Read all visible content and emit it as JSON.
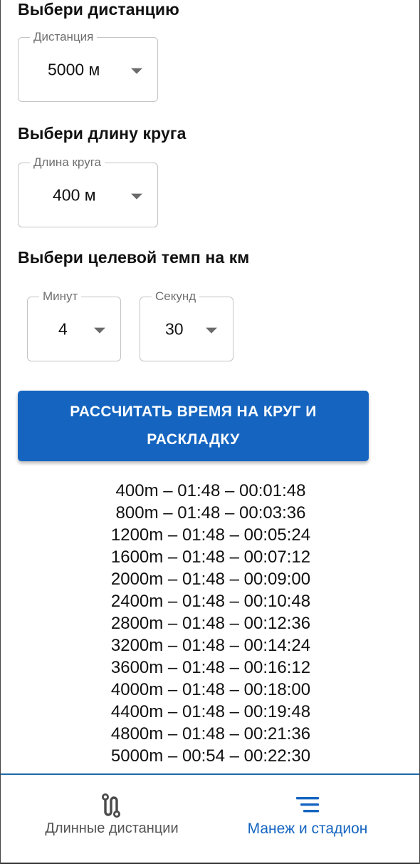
{
  "distance": {
    "title": "Выбери дистанцию",
    "select_label": "Дистанция",
    "value": "5000 м"
  },
  "lap": {
    "title": "Выбери длину круга",
    "select_label": "Длина круга",
    "value": "400 м"
  },
  "pace": {
    "title": "Выбери целевой темп на км",
    "minutes_label": "Минут",
    "minutes_value": "4",
    "seconds_label": "Секунд",
    "seconds_value": "30"
  },
  "calc_button": {
    "line1": "РАССЧИТАТЬ ВРЕМЯ НА КРУГ И",
    "line2": "РАСКЛАДКУ"
  },
  "splits": [
    "400m – 01:48 – 00:01:48",
    "800m – 01:48 – 00:03:36",
    "1200m – 01:48 – 00:05:24",
    "1600m – 01:48 – 00:07:12",
    "2000m – 01:48 – 00:09:00",
    "2400m – 01:48 – 00:10:48",
    "2800m – 01:48 – 00:12:36",
    "3200m – 01:48 – 00:14:24",
    "3600m – 01:48 – 00:16:12",
    "4000m – 01:48 – 00:18:00",
    "4400m – 01:48 – 00:19:48",
    "4800m – 01:48 – 00:21:36",
    "5000m – 00:54 – 00:22:30"
  ],
  "bottom_nav": {
    "items": [
      {
        "label": "Длинные дистанции",
        "icon": "route-icon",
        "active": false
      },
      {
        "label": "Манеж и стадион",
        "icon": "menu-lines-icon",
        "active": true
      }
    ],
    "active_color": "#1565c0"
  }
}
